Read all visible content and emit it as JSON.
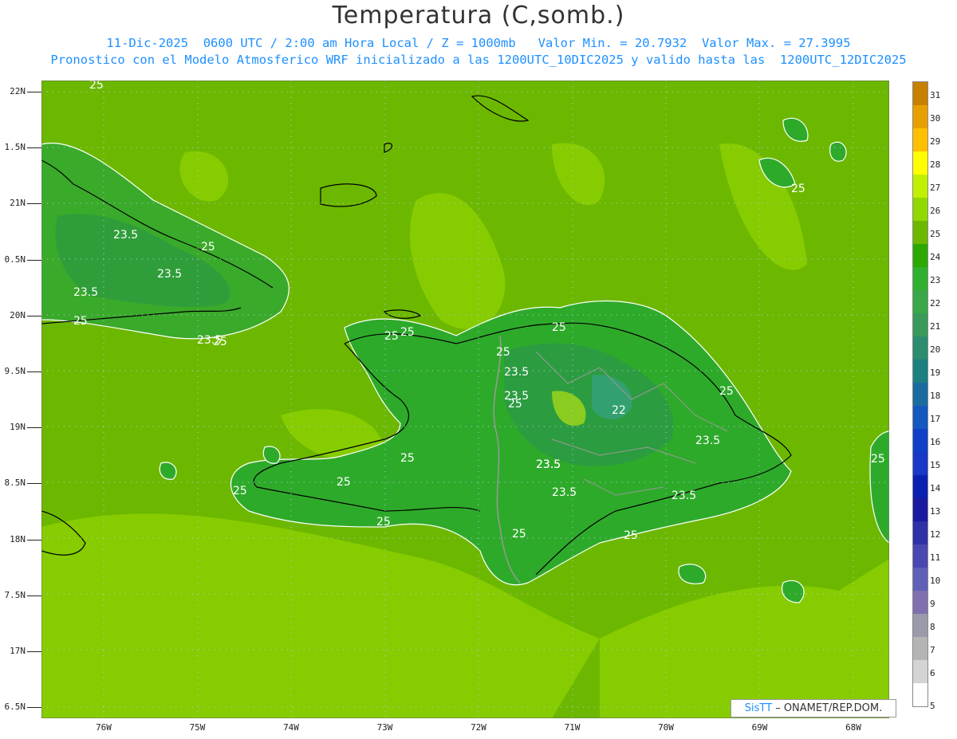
{
  "header": {
    "title": "Temperatura (C,somb.)",
    "subtitle1": "11-Dic-2025  0600 UTC / 2:00 am Hora Local / Z = 1000mb   Valor Min. = 20.7932  Valor Max. = 27.3995",
    "subtitle2": "Pronostico con el Modelo Atmosferico WRF inicializado a las 1200UTC_10DIC2025 y valido hasta las  1200UTC_12DIC2025"
  },
  "axes": {
    "lat_labels": [
      "22N",
      "1.5N",
      "21N",
      "0.5N",
      "20N",
      "9.5N",
      "19N",
      "8.5N",
      "18N",
      "7.5N",
      "17N",
      "6.5N"
    ],
    "lon_labels": [
      "76W",
      "75W",
      "74W",
      "73W",
      "72W",
      "71W",
      "70W",
      "69W",
      "68W"
    ]
  },
  "contours": {
    "labels": [
      {
        "text": "25"
      },
      {
        "text": "23.5"
      },
      {
        "text": "25"
      },
      {
        "text": "23.5"
      },
      {
        "text": "23.5"
      },
      {
        "text": "23.5"
      },
      {
        "text": "25"
      },
      {
        "text": "25"
      },
      {
        "text": "25"
      },
      {
        "text": "25"
      },
      {
        "text": "25"
      },
      {
        "text": "25"
      },
      {
        "text": "23.5"
      },
      {
        "text": "23.5"
      },
      {
        "text": "25"
      },
      {
        "text": "23.5"
      },
      {
        "text": "22"
      },
      {
        "text": "25"
      },
      {
        "text": "23.5"
      },
      {
        "text": "25"
      },
      {
        "text": "25"
      },
      {
        "text": "25"
      },
      {
        "text": "25"
      },
      {
        "text": "23.5"
      },
      {
        "text": "23.5"
      },
      {
        "text": "23.5"
      },
      {
        "text": "25"
      },
      {
        "text": "25"
      },
      {
        "text": "25"
      },
      {
        "text": "25"
      }
    ]
  },
  "colorbar": {
    "labels": [
      "31",
      "30",
      "29",
      "28",
      "27",
      "26",
      "25",
      "24",
      "23",
      "22",
      "21",
      "20",
      "19",
      "18",
      "17",
      "16",
      "15",
      "14",
      "13",
      "12",
      "11",
      "10",
      "9",
      "8",
      "7",
      "6",
      "5"
    ],
    "colors": [
      "#c88000",
      "#e8a000",
      "#ffc000",
      "#ffff00",
      "#c0f000",
      "#90d800",
      "#6cb800",
      "#2ca800",
      "#30b030",
      "#38a848",
      "#3a9a5a",
      "#2c8c70",
      "#1c8080",
      "#1a6ca0",
      "#1458c0",
      "#1040c8",
      "#1838c8",
      "#0a20b0",
      "#1a1aa0",
      "#3030a8",
      "#4848b0",
      "#6060b8",
      "#8070b0",
      "#9a9aaa",
      "#b4b4b4",
      "#d4d4d4",
      "#ffffff"
    ]
  },
  "credit": {
    "brand": "SisTT",
    "text": " – ONAMET/REP.DOM."
  }
}
